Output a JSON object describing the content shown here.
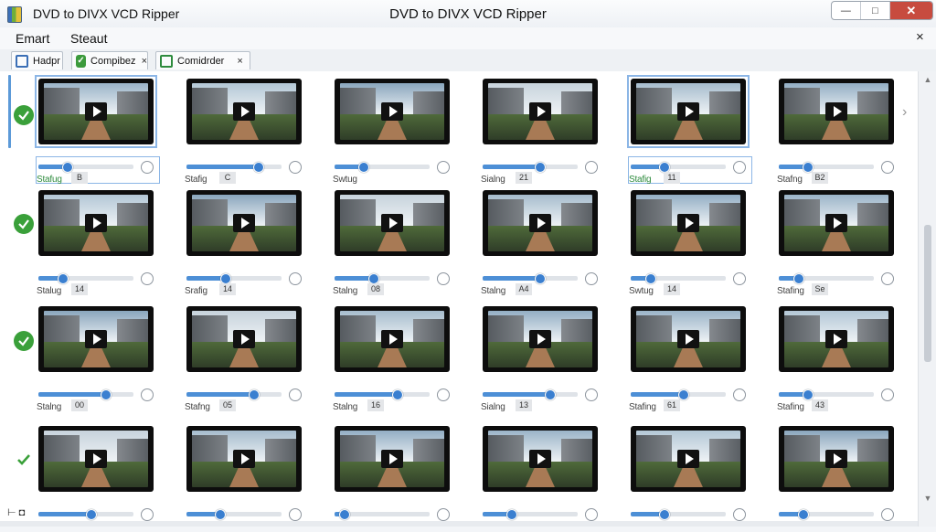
{
  "window": {
    "title_left": "DVD to DIVX VCD Ripper",
    "title_center": "DVD to DIVX VCD Ripper",
    "min": "—",
    "max": "□",
    "close": "✕"
  },
  "menu": {
    "items": [
      {
        "label": "Emart"
      },
      {
        "label": "Steaut"
      }
    ],
    "close": "×"
  },
  "tabs": [
    {
      "label": "Hadpr",
      "icon": "blue-square-icon"
    },
    {
      "label": "Compibez",
      "icon": "green-check-icon",
      "x": "×"
    },
    {
      "label": "Comidrder",
      "icon": "green-square-icon",
      "x": "×"
    }
  ],
  "rows": [
    {
      "check": "filled",
      "cards": [
        {
          "label": "Stafug",
          "num": "B",
          "progress": 0.3,
          "selected": true
        },
        {
          "label": "Stafig",
          "num": "C",
          "progress": 0.75
        },
        {
          "label": "Swtug",
          "num": "",
          "progress": 0.3
        },
        {
          "label": "Sialng",
          "num": "21",
          "progress": 0.6
        },
        {
          "label": "Stafig",
          "num": "11",
          "progress": 0.35,
          "selected": true
        },
        {
          "label": "Stafng",
          "num": "B2",
          "progress": 0.3
        }
      ]
    },
    {
      "check": "filled",
      "cards": [
        {
          "label": "Stalug",
          "num": "14",
          "progress": 0.25
        },
        {
          "label": "Srafig",
          "num": "14",
          "progress": 0.4
        },
        {
          "label": "Stalng",
          "num": "08",
          "progress": 0.4
        },
        {
          "label": "Stalng",
          "num": "A4",
          "progress": 0.6
        },
        {
          "label": "Swtug",
          "num": "14",
          "progress": 0.2
        },
        {
          "label": "Stafing",
          "num": "Se",
          "progress": 0.2
        }
      ]
    },
    {
      "check": "filled",
      "cards": [
        {
          "label": "Stalng",
          "num": "00",
          "progress": 0.7
        },
        {
          "label": "Stafng",
          "num": "05",
          "progress": 0.7
        },
        {
          "label": "Stalng",
          "num": "16",
          "progress": 0.65
        },
        {
          "label": "Sialng",
          "num": "13",
          "progress": 0.7
        },
        {
          "label": "Stafing",
          "num": "61",
          "progress": 0.55
        },
        {
          "label": "Stafing",
          "num": "43",
          "progress": 0.3
        }
      ]
    },
    {
      "check": "plain",
      "cards": [
        {
          "label": "",
          "num": "",
          "progress": 0.55
        },
        {
          "label": "",
          "num": "",
          "progress": 0.35
        },
        {
          "label": "",
          "num": "",
          "progress": 0.1
        },
        {
          "label": "",
          "num": "",
          "progress": 0.3
        },
        {
          "label": "",
          "num": "",
          "progress": 0.35
        },
        {
          "label": "",
          "num": "",
          "progress": 0.25
        }
      ]
    }
  ],
  "scrollbar": {
    "up": "▲",
    "down": "▼"
  },
  "bottom_tool": "⊢ ◘"
}
